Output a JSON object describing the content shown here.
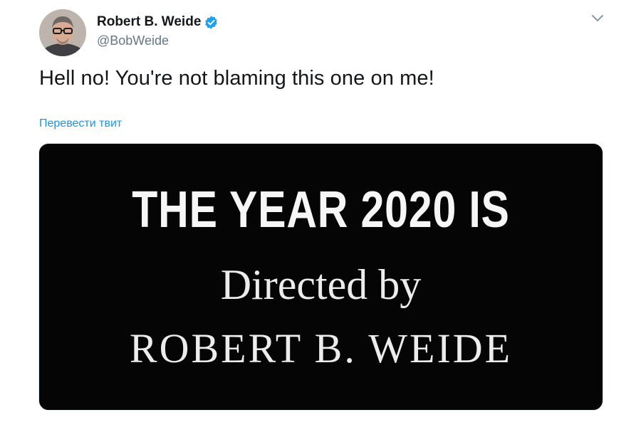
{
  "author": {
    "display_name": "Robert B. Weide",
    "handle": "@BobWeide",
    "verified": true
  },
  "tweet": {
    "text": "Hell no! You're not blaming this one on me!",
    "translate_label": "Перевести твит"
  },
  "media": {
    "line1": "THE YEAR 2020 IS",
    "line2": "Directed by",
    "line3": "ROBERT B. WEIDE"
  },
  "icons": {
    "verified": "verified-badge-icon",
    "menu": "chevron-down-icon"
  },
  "colors": {
    "accent": "#1da1f2",
    "link": "#1b95e0",
    "text_primary": "#14171a",
    "text_secondary": "#657786",
    "media_background": "#050505"
  }
}
